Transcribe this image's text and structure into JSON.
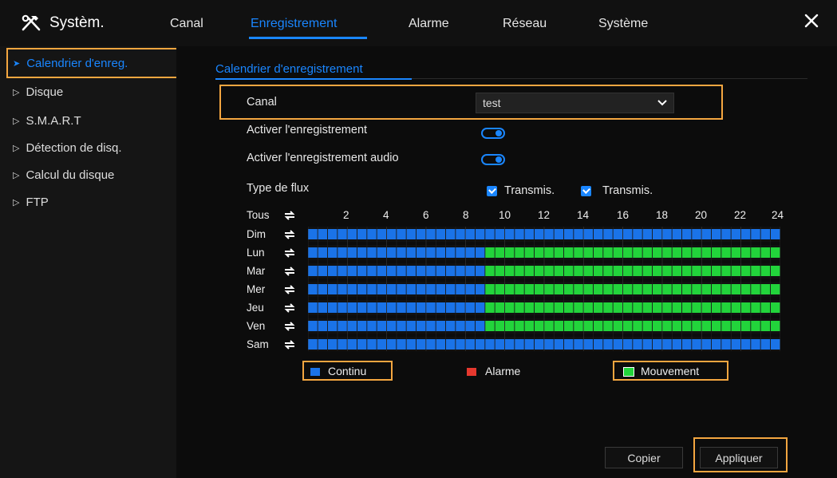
{
  "header": {
    "title": "Systèm.",
    "tabs": [
      {
        "label": "Canal",
        "active": false
      },
      {
        "label": "Enregistrement",
        "active": true
      },
      {
        "label": "Alarme",
        "active": false
      },
      {
        "label": "Réseau",
        "active": false
      },
      {
        "label": "Système",
        "active": false
      }
    ]
  },
  "sidebar": {
    "items": [
      {
        "label": "Calendrier d'enreg.",
        "active": true
      },
      {
        "label": "Disque",
        "active": false
      },
      {
        "label": "S.M.A.R.T",
        "active": false
      },
      {
        "label": "Détection de disq.",
        "active": false
      },
      {
        "label": "Calcul du disque",
        "active": false
      },
      {
        "label": "FTP",
        "active": false
      }
    ]
  },
  "main": {
    "subtab": "Calendrier d'enregistrement",
    "channel_label": "Canal",
    "channel_value": "test",
    "record_enable_label": "Activer l'enregistrement",
    "record_enable": true,
    "audio_enable_label": "Activer l'enregistrement audio",
    "audio_enable": true,
    "stream_type_label": "Type de flux",
    "stream_options": [
      {
        "label": "Transmis.",
        "checked": true
      },
      {
        "label": "Transmis.",
        "checked": true
      }
    ]
  },
  "schedule": {
    "all_label": "Tous",
    "hour_labels": [
      "2",
      "4",
      "6",
      "8",
      "10",
      "12",
      "14",
      "16",
      "18",
      "20",
      "22",
      "24"
    ],
    "days": [
      "Dim",
      "Lun",
      "Mar",
      "Mer",
      "Jeu",
      "Ven",
      "Sam"
    ],
    "slots_per_day": 48,
    "motion_ranges": [
      [],
      [
        [
          18,
          47
        ]
      ],
      [
        [
          18,
          47
        ]
      ],
      [
        [
          18,
          47
        ]
      ],
      [
        [
          18,
          47
        ]
      ],
      [
        [
          18,
          47
        ]
      ],
      []
    ],
    "colors": {
      "continuous": "#1a73e8",
      "motion": "#22d43b",
      "alarm": "#e6382e",
      "empty": "#111111"
    }
  },
  "legend": {
    "continuous": "Continu",
    "alarm": "Alarme",
    "motion": "Mouvement"
  },
  "buttons": {
    "copy": "Copier",
    "apply": "Appliquer"
  }
}
